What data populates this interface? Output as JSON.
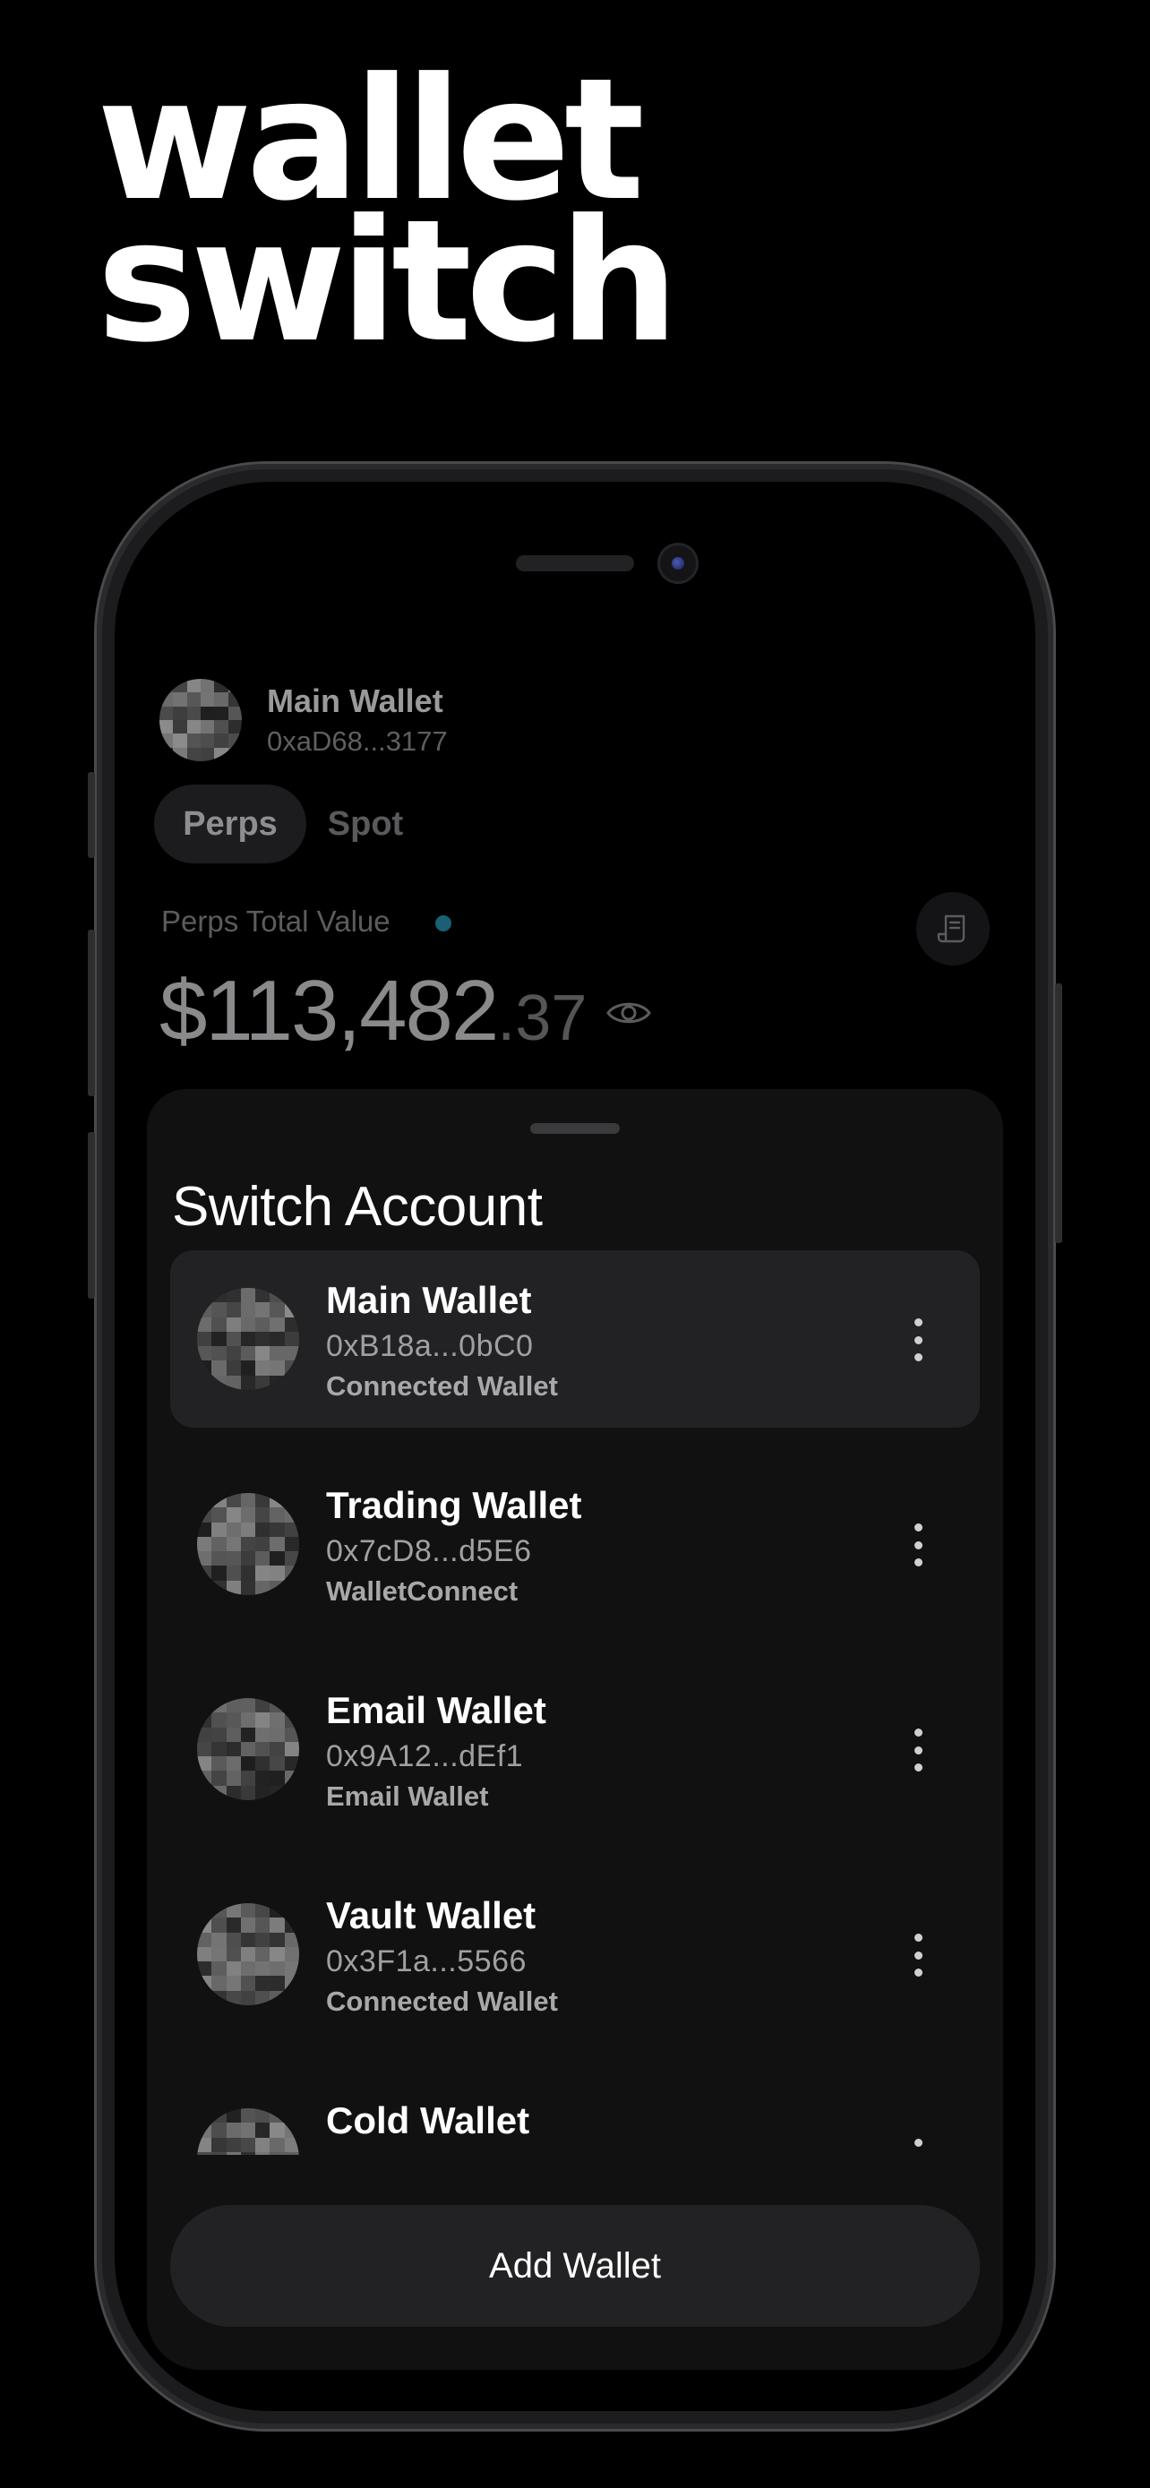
{
  "hero": {
    "line1": "wallet",
    "line2": "switch"
  },
  "header": {
    "wallet_name": "Main Wallet",
    "wallet_address": "0xaD68...3177"
  },
  "tabs": [
    {
      "label": "Perps",
      "active": true
    },
    {
      "label": "Spot",
      "active": false
    }
  ],
  "portfolio": {
    "label": "Perps Total Value",
    "value_main": "$113,482",
    "value_cents": ".37"
  },
  "icons": {
    "receipt": "receipt-icon",
    "eye": "eye-icon",
    "menu": "more-vertical-icon"
  },
  "sheet": {
    "title": "Switch Account",
    "wallets": [
      {
        "name": "Main Wallet",
        "address": "0xB18a...0bC0",
        "type": "Connected Wallet",
        "selected": true
      },
      {
        "name": "Trading Wallet",
        "address": "0x7cD8...d5E6",
        "type": "WalletConnect",
        "selected": false
      },
      {
        "name": "Email Wallet",
        "address": "0x9A12...dEf1",
        "type": "Email Wallet",
        "selected": false
      },
      {
        "name": "Vault Wallet",
        "address": "0x3F1a...5566",
        "type": "Connected Wallet",
        "selected": false
      },
      {
        "name": "Cold Wallet",
        "address": "",
        "type": "",
        "selected": false
      }
    ],
    "add_button": "Add Wallet"
  },
  "colors": {
    "background": "#000000",
    "sheet": "#111111",
    "selected_row": "#222224",
    "status_dot": "#1a5f75"
  }
}
